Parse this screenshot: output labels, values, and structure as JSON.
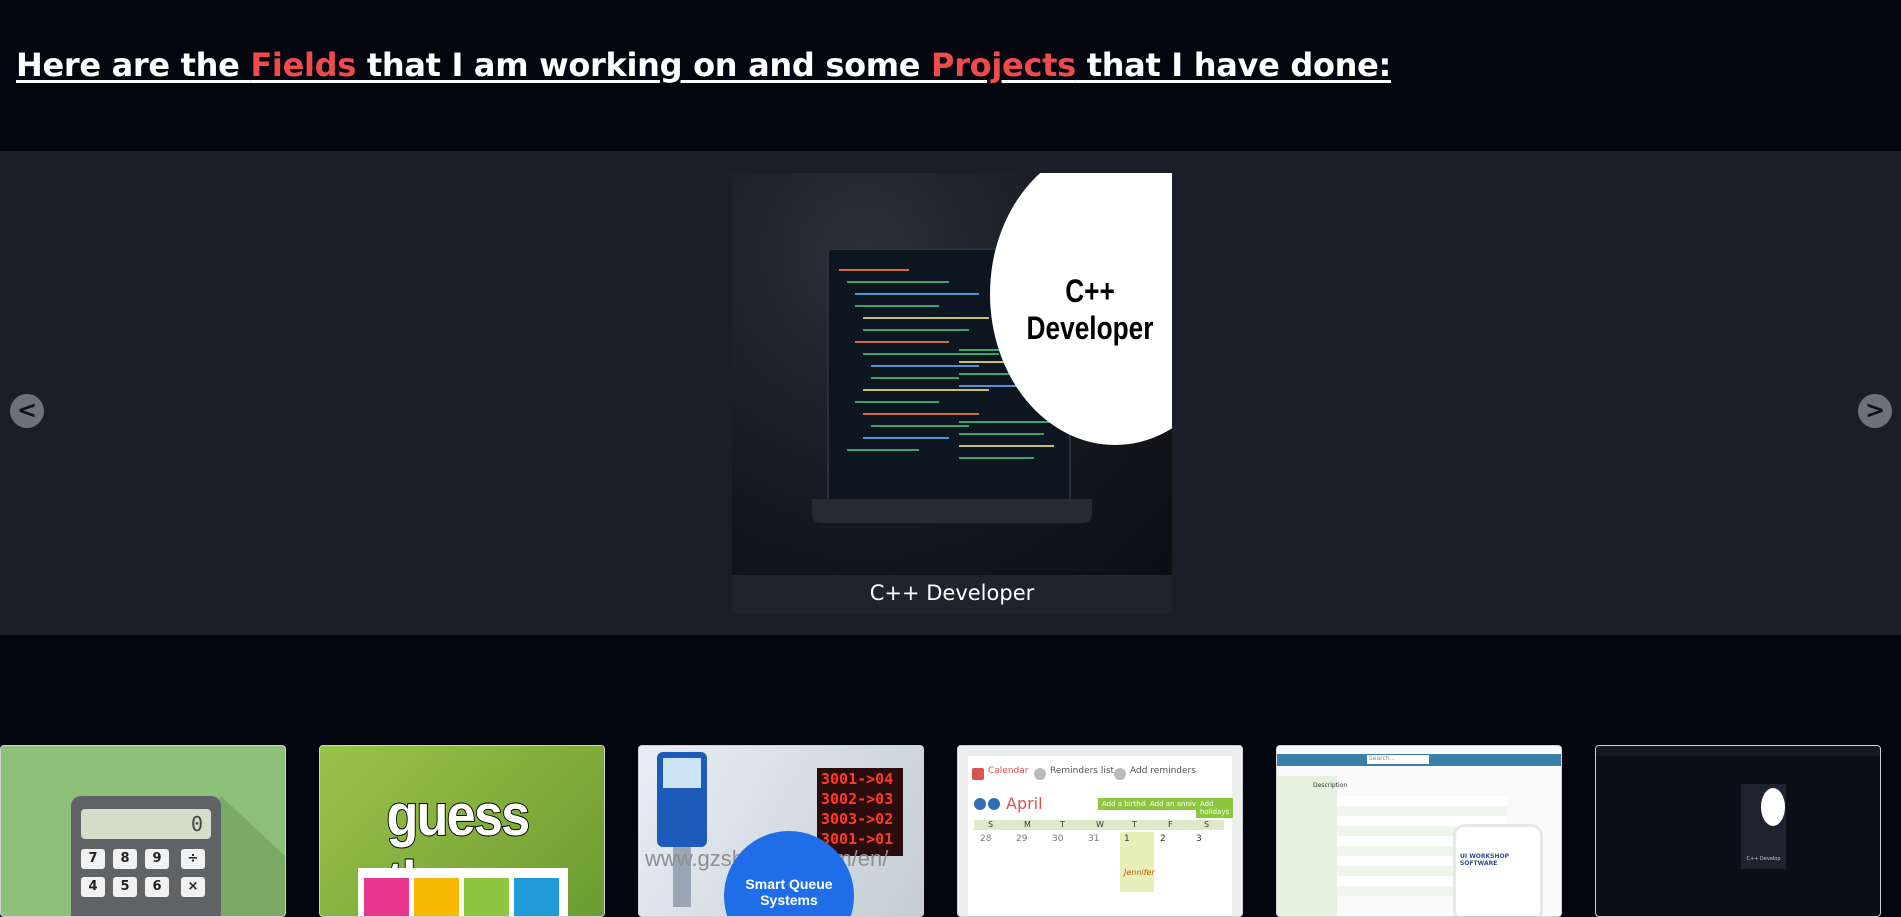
{
  "heading": {
    "part1": "Here are the ",
    "highlight1": "Fields",
    "part2": " that I am working on and some ",
    "highlight2": "Projects",
    "part3": " that I have done:"
  },
  "carousel": {
    "prev_label": "<",
    "next_label": ">",
    "slide": {
      "image_text": "C++ Developer",
      "caption": "C++ Developer"
    }
  },
  "projects": {
    "calculator": {
      "display": "0",
      "keys": [
        "7",
        "8",
        "9",
        "÷",
        "4",
        "5",
        "6",
        "×"
      ]
    },
    "guess_game": {
      "title": "guess the"
    },
    "queue_system": {
      "board_lines": [
        "3001->04",
        "3002->03",
        "3003->02",
        "3001->01"
      ],
      "watermark": "www.gzshangxu.com/en/",
      "badge": "Smart Queue Systems"
    },
    "calendar_app": {
      "tabs": [
        "Calendar",
        "Reminders list",
        "Add reminders"
      ],
      "month": "April",
      "buttons": [
        "Add a birthday",
        "Add an anniversary",
        "Add holidays"
      ],
      "weekdays": [
        "S",
        "M",
        "T",
        "W",
        "T",
        "F",
        "S"
      ],
      "days": [
        "28",
        "29",
        "30",
        "31",
        "1",
        "2",
        "3"
      ],
      "event": "Jennifer"
    },
    "workshop_software": {
      "search": "Search...",
      "column": "Description",
      "brand": "UI WORKSHOP SOFTWARE"
    },
    "portfolio_preview": {
      "caption": "C++ Develop"
    }
  },
  "colors": {
    "background": "#03050f",
    "carousel_bg": "#1b1e28",
    "highlight": "#f04a4a"
  }
}
